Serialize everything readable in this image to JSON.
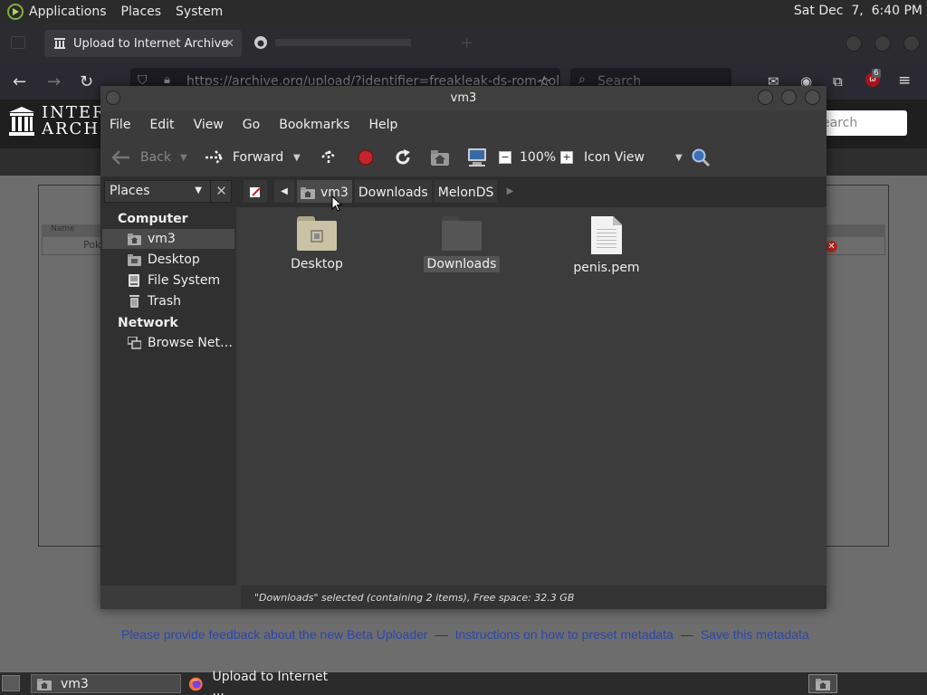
{
  "top_panel": {
    "menus": [
      "Applications",
      "Places",
      "System"
    ],
    "clock": "Sat Dec  7,  6:40 PM"
  },
  "firefox": {
    "active_tab": "Upload to Internet Archive",
    "url": "https://archive.org/upload/?identifier=freakleak-ds-rom-coll",
    "search_placeholder": "Search",
    "extension_badge": "6"
  },
  "internet_archive": {
    "logo_line1": "INTERN",
    "logo_line2": "ARCHIV",
    "search_placeholder": "earch",
    "table_header_name": "Name",
    "table_row_name": "Pok",
    "footer_links": [
      "Please provide feedback about the new Beta Uploader",
      "Instructions on how to preset metadata",
      "Save this metadata"
    ],
    "footer_separator": "—"
  },
  "window": {
    "title": "vm3",
    "menus": [
      "File",
      "Edit",
      "View",
      "Go",
      "Bookmarks",
      "Help"
    ],
    "toolbar": {
      "back": "Back",
      "forward": "Forward",
      "zoom": "100%",
      "view_mode": "Icon View"
    },
    "sidebar_combo": "Places",
    "breadcrumbs": [
      "vm3",
      "Downloads",
      "MelonDS"
    ],
    "sidebar": {
      "computer_header": "Computer",
      "computer_items": [
        "vm3",
        "Desktop",
        "File System",
        "Trash"
      ],
      "network_header": "Network",
      "network_items": [
        "Browse Net…"
      ]
    },
    "files": [
      {
        "name": "Desktop",
        "kind": "folder"
      },
      {
        "name": "Downloads",
        "kind": "folder",
        "selected": true
      },
      {
        "name": "penis.pem",
        "kind": "document"
      }
    ],
    "status": "\"Downloads\" selected (containing 2 items), Free space: 32.3 GB"
  },
  "bottom_panel": {
    "tasks": [
      "vm3",
      "Upload to Internet ..."
    ]
  },
  "colors": {
    "accent_green": "#7fae3b",
    "link_blue": "#2b47a8",
    "stop_red": "#c0262b",
    "folder_tan": "#c9c2a4",
    "folder_dark": "#555555"
  }
}
